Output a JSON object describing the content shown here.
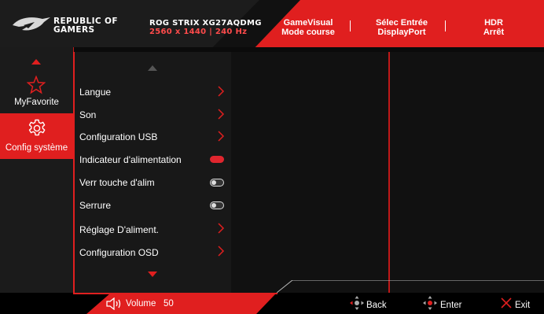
{
  "header": {
    "brand_line1": "REPUBLIC OF",
    "brand_line2": "GAMERS",
    "model_name": "ROG STRIX XG27AQDMG",
    "model_specs": "2560 x 1440  | 240 Hz",
    "status": [
      {
        "line1": "GameVisual",
        "line2": "Mode course"
      },
      {
        "line1": "Sélec Entrée",
        "line2": "DisplayPort"
      },
      {
        "line1": "HDR",
        "line2": "Arrêt"
      }
    ]
  },
  "sidebar": {
    "items": [
      {
        "label": "MyFavorite",
        "icon": "star-icon"
      },
      {
        "label": "Config système",
        "icon": "gear-icon",
        "selected": true
      }
    ]
  },
  "menu": {
    "items": [
      {
        "label": "Langue",
        "control": "chevron"
      },
      {
        "label": "Son",
        "control": "chevron"
      },
      {
        "label": "Configuration USB",
        "control": "chevron"
      },
      {
        "label": "Indicateur d'alimentation",
        "control": "toggle",
        "state": "on"
      },
      {
        "label": "Verr touche d'alim",
        "control": "toggle",
        "state": "off"
      },
      {
        "label": "Serrure",
        "control": "toggle",
        "state": "off"
      },
      {
        "label": "Réglage D'aliment.",
        "control": "chevron"
      },
      {
        "label": "Configuration OSD",
        "control": "chevron"
      }
    ]
  },
  "footer": {
    "volume_label": "Volume",
    "volume_value": "50",
    "back_label": "Back",
    "enter_label": "Enter",
    "exit_label": "Exit"
  },
  "colors": {
    "accent": "#e01f1f",
    "background": "#0b0b0b"
  }
}
